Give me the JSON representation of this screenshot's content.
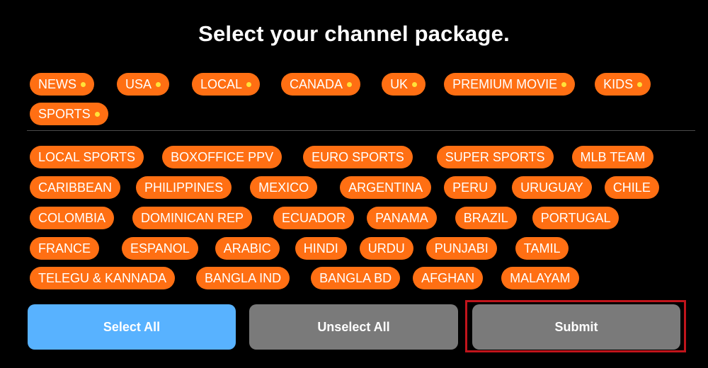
{
  "title": "Select your channel package.",
  "packages": [
    "NEWS",
    "USA",
    "LOCAL",
    "CANADA",
    "UK",
    "PREMIUM MOVIE",
    "KIDS",
    "SPORTS"
  ],
  "categories": {
    "row1": [
      "LOCAL SPORTS",
      "BOXOFFICE PPV",
      "EURO SPORTS",
      "SUPER SPORTS",
      "MLB TEAM"
    ],
    "row2": [
      "CARIBBEAN",
      "PHILIPPINES",
      "MEXICO",
      "ARGENTINA",
      "PERU",
      "URUGUAY",
      "CHILE"
    ],
    "row3": [
      "COLOMBIA",
      "DOMINICAN REP",
      "ECUADOR",
      "PANAMA",
      "BRAZIL",
      "PORTUGAL"
    ],
    "row4": [
      "FRANCE",
      "ESPANOL",
      "ARABIC",
      "HINDI",
      "URDU",
      "PUNJABI",
      "TAMIL"
    ],
    "row5": [
      "TELEGU & KANNADA",
      "BANGLA IND",
      "BANGLA BD",
      "AFGHAN",
      "MALAYAM"
    ]
  },
  "buttons": {
    "select_all": "Select All",
    "unselect_all": "Unselect All",
    "submit": "Submit"
  },
  "colors": {
    "chip": "#ff6f13",
    "chip_dot": "#ffe23a",
    "select_all": "#58b2ff",
    "neutral_button": "#7a7a7a",
    "highlight_outline": "#c0141b"
  }
}
